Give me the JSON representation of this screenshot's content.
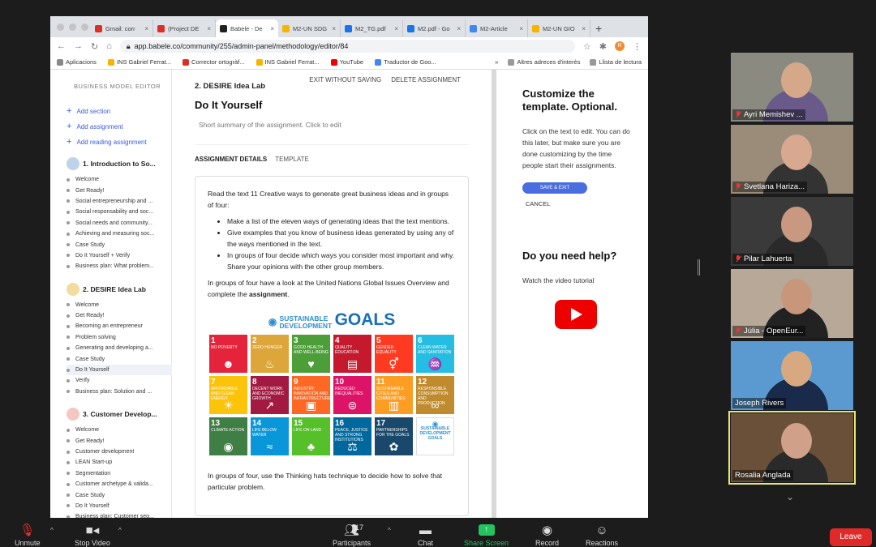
{
  "browser": {
    "tabs": [
      {
        "label": "Gmail: corr",
        "color": "#d93025"
      },
      {
        "label": "(Project DE",
        "color": "#d93025"
      },
      {
        "label": "Babele - De",
        "color": "#222222",
        "active": true
      },
      {
        "label": "M2-UN SDG",
        "color": "#f4b400"
      },
      {
        "label": "M2_TG.pdf",
        "color": "#1a73e8"
      },
      {
        "label": "M2.pdf - Go",
        "color": "#1a73e8"
      },
      {
        "label": "M2-Article",
        "color": "#4285f4"
      },
      {
        "label": "M2-UN GIO",
        "color": "#f4b400"
      }
    ],
    "new_tab": "+",
    "url": "app.babele.co/community/255/admin-panel/methodology/editor/84",
    "bookmarks": [
      {
        "label": "Aplicacions",
        "color": "#888"
      },
      {
        "label": "INS Gabriel Ferrat...",
        "color": "#f4b400"
      },
      {
        "label": "Corrector ortogràf...",
        "color": "#d93025"
      },
      {
        "label": "INS Gabriel Ferrat...",
        "color": "#f4b400"
      },
      {
        "label": "YouTube",
        "color": "#e00"
      },
      {
        "label": "Traductor de Goo...",
        "color": "#4285f4"
      }
    ],
    "other_bookmarks": "Altres adreces d'interès",
    "reading_list": "Llista de lectura",
    "profile_initial": "R"
  },
  "sidebar": {
    "title": "BUSINESS MODEL EDITOR",
    "actions": [
      "Add section",
      "Add assignment",
      "Add reading assignment"
    ],
    "sections": [
      {
        "title": "1. Introduction to So...",
        "color": "#bcd3e8",
        "items": [
          "Welcome",
          "Get Ready!",
          "Social entrepreneurship and ...",
          "Social responsability and soc...",
          "Social needs and community...",
          "Achieving and measuring soc...",
          "Case Study",
          "Do It Yourself + Verify",
          "Business plan: What problem..."
        ]
      },
      {
        "title": "2. DESIRE Idea Lab",
        "color": "#f3dca0",
        "items": [
          "Welcome",
          "Get Ready!",
          "Becoming an entrepreneur",
          "Problem solving",
          "Generating and developing a...",
          "Case Study",
          "Do It Yourself",
          "Verify",
          "Business plan: Solution and ..."
        ]
      },
      {
        "title": "3. Customer Develop...",
        "color": "#f4c7c3",
        "items": [
          "Welcome",
          "Get Ready!",
          "Customer development",
          "LEAN Start-up",
          "Segmentation",
          "Customer archetype & valida...",
          "Case Study",
          "Do It Yourself",
          "Business plan: Customer seg..."
        ]
      }
    ]
  },
  "main": {
    "exit": "EXIT WITHOUT SAVING",
    "delete": "DELETE ASSIGNMENT",
    "breadcrumb": "2. DESIRE Idea Lab",
    "title": "Do It Yourself",
    "summary": "Short summary of the assignment. Click to edit",
    "tab_details": "ASSIGNMENT DETAILS",
    "tab_template": "TEMPLATE",
    "intro": "Read the text 11 Creative ways to generate great business ideas and in groups of four:",
    "bullets": [
      "Make a list of the eleven ways of generating ideas that the text mentions.",
      "Give examples that you know of business ideas generated by using any of the ways mentioned in the text.",
      "In groups of four decide which ways you consider most important and why. Share your opinions with the other group members."
    ],
    "para2_a": "In groups of four have a look at the United Nations Global Issues Overview and complete the ",
    "para2_b": "assignment",
    "para2_c": ".",
    "sdg_title_1": "SUSTAINABLE",
    "sdg_title_2": "DEVELOPMENT",
    "sdg_goals": "GOALS",
    "sdg_tiles": [
      {
        "n": "1",
        "label": "NO POVERTY",
        "color": "#e5243b",
        "sym": "☻"
      },
      {
        "n": "2",
        "label": "ZERO HUNGER",
        "color": "#dda63a",
        "sym": "♨"
      },
      {
        "n": "3",
        "label": "GOOD HEALTH AND WELL-BEING",
        "color": "#4c9f38",
        "sym": "♥"
      },
      {
        "n": "4",
        "label": "QUALITY EDUCATION",
        "color": "#c5192d",
        "sym": "▤"
      },
      {
        "n": "5",
        "label": "GENDER EQUALITY",
        "color": "#ff3a21",
        "sym": "⚥"
      },
      {
        "n": "6",
        "label": "CLEAN WATER AND SANITATION",
        "color": "#26bde2",
        "sym": "♒"
      },
      {
        "n": "7",
        "label": "AFFORDABLE AND CLEAN ENERGY",
        "color": "#fcc30b",
        "sym": "☀"
      },
      {
        "n": "8",
        "label": "DECENT WORK AND ECONOMIC GROWTH",
        "color": "#a21942",
        "sym": "↗"
      },
      {
        "n": "9",
        "label": "INDUSTRY, INNOVATION AND INFRASTRUCTURE",
        "color": "#fd6925",
        "sym": "▣"
      },
      {
        "n": "10",
        "label": "REDUCED INEQUALITIES",
        "color": "#dd1367",
        "sym": "⊜"
      },
      {
        "n": "11",
        "label": "SUSTAINABLE CITIES AND COMMUNITIES",
        "color": "#fd9d24",
        "sym": "▥"
      },
      {
        "n": "12",
        "label": "RESPONSIBLE CONSUMPTION AND PRODUCTION",
        "color": "#bf8b2e",
        "sym": "∞"
      },
      {
        "n": "13",
        "label": "CLIMATE ACTION",
        "color": "#3f7e44",
        "sym": "◉"
      },
      {
        "n": "14",
        "label": "LIFE BELOW WATER",
        "color": "#0a97d9",
        "sym": "≈"
      },
      {
        "n": "15",
        "label": "LIFE ON LAND",
        "color": "#56c02b",
        "sym": "♣"
      },
      {
        "n": "16",
        "label": "PEACE, JUSTICE AND STRONG INSTITUTIONS",
        "color": "#00689d",
        "sym": "⚖"
      },
      {
        "n": "17",
        "label": "PARTNERSHIPS FOR THE GOALS",
        "color": "#19486a",
        "sym": "✿"
      },
      {
        "n": "",
        "label": "SUSTAINABLE DEVELOPMENT GOALS",
        "color": "#ffffff",
        "sym": ""
      }
    ],
    "para3": "In groups of four, use the Thinking hats technique to decide how to solve that particular problem."
  },
  "right": {
    "title": "Customize the template. Optional.",
    "desc": "Click on the text to edit. You can do this later, but make sure you are done customizing by the time people start their assignments.",
    "save": "SAVE & EXIT",
    "cancel": "CANCEL",
    "help_title": "Do you need help?",
    "help_text": "Watch the video tutorial"
  },
  "participants": [
    {
      "name": "Ayri Memishev ...",
      "muted": true,
      "bg": "#8a8a80",
      "face": "#d6a88a",
      "body": "#6a5a8a"
    },
    {
      "name": "Svetlana Hariza...",
      "muted": true,
      "bg": "#9a8c78",
      "face": "#d8a890",
      "body": "#333"
    },
    {
      "name": "Pilar Lahuerta",
      "muted": true,
      "bg": "#3a3a3a",
      "face": "#c99880",
      "body": "#2a2a2a"
    },
    {
      "name": "Júlia - OpenEur...",
      "muted": true,
      "bg": "#b8a898",
      "face": "#c8967a",
      "body": "#222"
    },
    {
      "name": "Joseph Rivers",
      "muted": false,
      "bg": "#5a9ad0",
      "face": "#d8a880",
      "body": "#1a2a4a"
    },
    {
      "name": "Rosalia Anglada",
      "muted": false,
      "bg": "#6a5038",
      "face": "#d0a088",
      "body": "#2a2a2a",
      "active": true
    }
  ],
  "toolbar": {
    "unmute": "Unmute",
    "stop_video": "Stop Video",
    "participants": "Participants",
    "participants_count": "17",
    "chat": "Chat",
    "share": "Share Screen",
    "record": "Record",
    "reactions": "Reactions",
    "leave": "Leave"
  }
}
